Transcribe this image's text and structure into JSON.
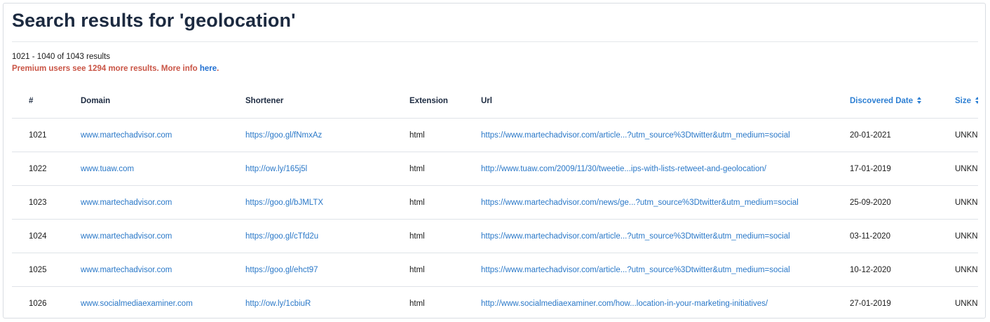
{
  "page": {
    "title": "Search results for 'geolocation'",
    "results_count": "1021 - 1040 of 1043 results",
    "premium_text": "Premium users see 1294 more results. More info ",
    "premium_link": "here",
    "premium_suffix": "."
  },
  "table": {
    "columns": {
      "num": "#",
      "domain": "Domain",
      "shortener": "Shortener",
      "extension": "Extension",
      "url": "Url",
      "discovered": "Discovered Date",
      "size": "Size"
    },
    "sort_icon": "sort-arrows-icon",
    "rows": [
      {
        "num": "1021",
        "domain": "www.martechadvisor.com",
        "shortener": "https://goo.gl/fNmxAz",
        "extension": "html",
        "url": "https://www.martechadvisor.com/article...?utm_source%3Dtwitter&utm_medium=social",
        "discovered": "20-01-2021",
        "size": "UNKNOWN"
      },
      {
        "num": "1022",
        "domain": "www.tuaw.com",
        "shortener": "http://ow.ly/165j5l",
        "extension": "html",
        "url": "http://www.tuaw.com/2009/11/30/tweetie...ips-with-lists-retweet-and-geolocation/",
        "discovered": "17-01-2019",
        "size": "UNKNOWN"
      },
      {
        "num": "1023",
        "domain": "www.martechadvisor.com",
        "shortener": "https://goo.gl/bJMLTX",
        "extension": "html",
        "url": "https://www.martechadvisor.com/news/ge...?utm_source%3Dtwitter&utm_medium=social",
        "discovered": "25-09-2020",
        "size": "UNKNOWN"
      },
      {
        "num": "1024",
        "domain": "www.martechadvisor.com",
        "shortener": "https://goo.gl/cTfd2u",
        "extension": "html",
        "url": "https://www.martechadvisor.com/article...?utm_source%3Dtwitter&utm_medium=social",
        "discovered": "03-11-2020",
        "size": "UNKNOWN"
      },
      {
        "num": "1025",
        "domain": "www.martechadvisor.com",
        "shortener": "https://goo.gl/ehct97",
        "extension": "html",
        "url": "https://www.martechadvisor.com/article...?utm_source%3Dtwitter&utm_medium=social",
        "discovered": "10-12-2020",
        "size": "UNKNOWN"
      },
      {
        "num": "1026",
        "domain": "www.socialmediaexaminer.com",
        "shortener": "http://ow.ly/1cbiuR",
        "extension": "html",
        "url": "http://www.socialmediaexaminer.com/how...location-in-your-marketing-initiatives/",
        "discovered": "27-01-2019",
        "size": "UNKNOWN"
      }
    ]
  },
  "colors": {
    "title": "#1c2a40",
    "link": "#2a78c8",
    "premium": "#c95445",
    "border": "#dfe3e8"
  }
}
